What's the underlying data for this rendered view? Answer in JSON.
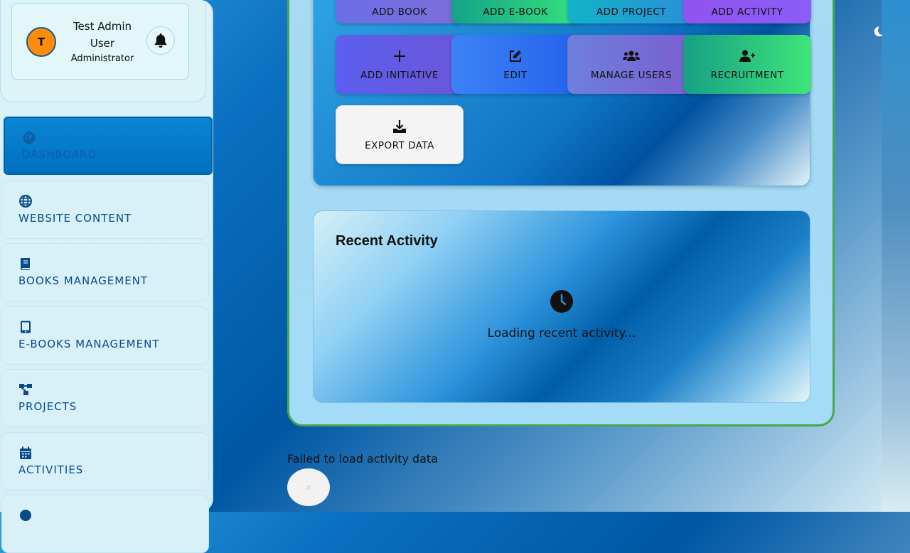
{
  "user": {
    "initial": "T",
    "name": "Test Admin User",
    "role": "Administrator"
  },
  "sidebar": {
    "items": [
      {
        "label": "DASHBOARD",
        "icon": "gauge-icon",
        "active": true
      },
      {
        "label": "WEBSITE CONTENT",
        "icon": "globe-icon"
      },
      {
        "label": "BOOKS MANAGEMENT",
        "icon": "book-icon"
      },
      {
        "label": "E-BOOKS MANAGEMENT",
        "icon": "tablet-icon"
      },
      {
        "label": "PROJECTS",
        "icon": "project-diagram-icon"
      },
      {
        "label": "ACTIVITIES",
        "icon": "calendar-icon"
      }
    ]
  },
  "quick_actions": {
    "row1": [
      "ADD BOOK",
      "ADD E-BOOK",
      "ADD PROJECT",
      "ADD ACTIVITY"
    ],
    "row2": [
      {
        "label": "ADD INITIATIVE",
        "icon": "plus-icon"
      },
      {
        "label": "EDIT",
        "icon": "edit-icon"
      },
      {
        "label": "MANAGE USERS",
        "icon": "users-icon"
      },
      {
        "label": "RECRUITMENT",
        "icon": "user-plus-icon"
      }
    ],
    "export": {
      "label": "EXPORT DATA",
      "icon": "download-icon"
    }
  },
  "recent_activity": {
    "title": "Recent Activity",
    "loading": "Loading recent activity..."
  },
  "error": {
    "message": "Failed to load activity data",
    "close_label": "×"
  },
  "theme_toggle": {
    "icon": "moon-icon"
  },
  "colors": {
    "avatar_bg": "#ff8c0a",
    "active_nav": "#0a86d4",
    "panel_border": "#47a84a",
    "nav_text": "#0a4a8a"
  }
}
